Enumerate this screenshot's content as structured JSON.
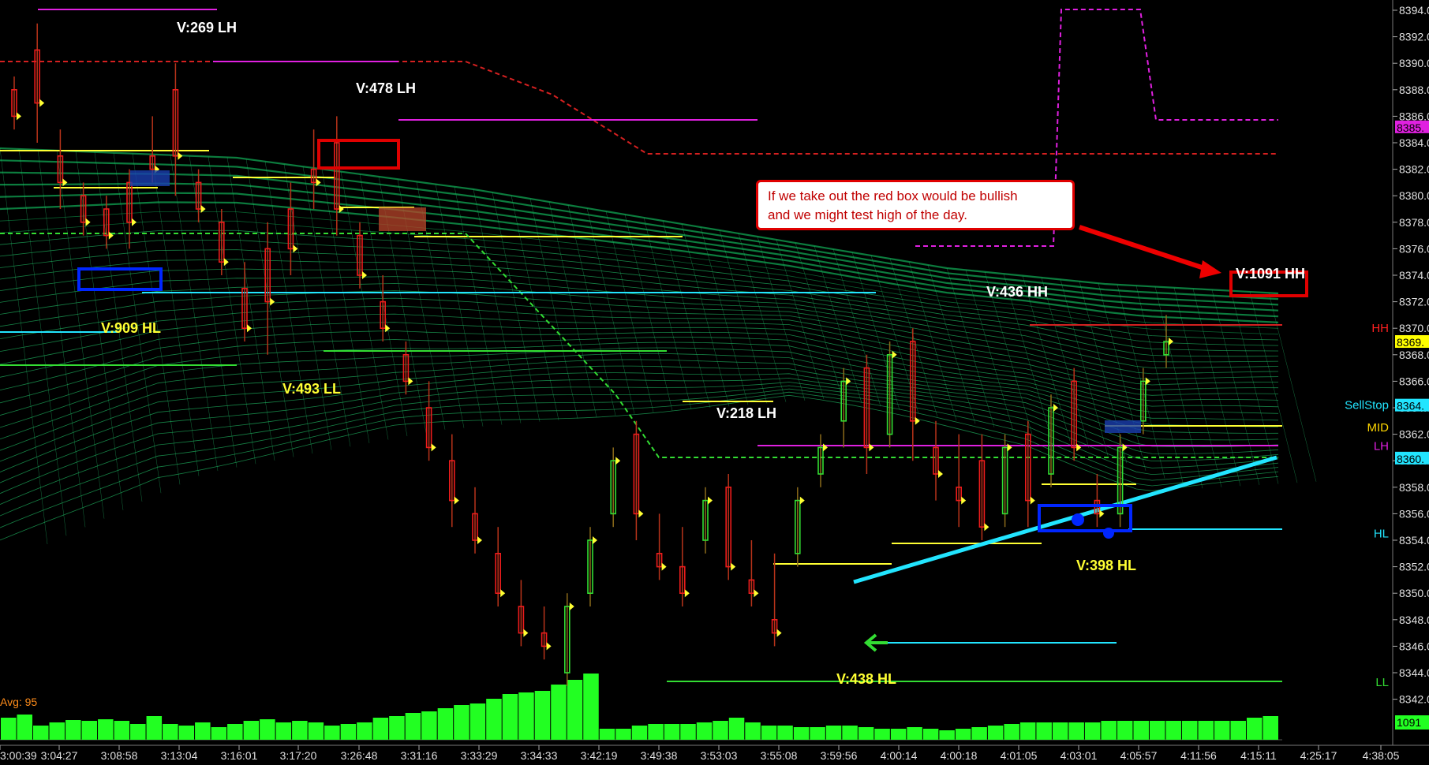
{
  "chart_data": {
    "type": "candlestick",
    "title": "",
    "ylim": [
      8342,
      8394.5
    ],
    "y_ticks": [
      "8394.0",
      "8392.0",
      "8390.0",
      "8388.0",
      "8386.0",
      "8384.0",
      "8382.0",
      "8380.0",
      "8378.0",
      "8376.0",
      "8374.0",
      "8372.0",
      "8370.0",
      "8368.0",
      "8366.0",
      "8364.0",
      "8362.0",
      "8360.0",
      "8358.0",
      "8356.0",
      "8354.0",
      "8352.0",
      "8350.0",
      "8348.0",
      "8346.0",
      "8344.0",
      "8342.0"
    ],
    "x_ticks": [
      "3:00:39",
      "3:04:27",
      "3:08:58",
      "3:13:04",
      "3:16:01",
      "3:17:20",
      "3:26:48",
      "3:31:16",
      "3:33:29",
      "3:34:33",
      "3:42:19",
      "3:49:38",
      "3:53:03",
      "3:55:08",
      "3:59:56",
      "4:00:14",
      "4:00:18",
      "4:01:05",
      "4:03:01",
      "4:05:57",
      "4:11:56",
      "4:15:11",
      "4:25:17",
      "4:38:05"
    ],
    "candles": [
      {
        "x": 0,
        "o": 8388,
        "h": 8389,
        "c": 8386,
        "l": 8385
      },
      {
        "x": 1,
        "o": 8391,
        "h": 8393,
        "c": 8387,
        "l": 8384
      },
      {
        "x": 2,
        "o": 8383,
        "h": 8385,
        "c": 8381,
        "l": 8379
      },
      {
        "x": 3,
        "o": 8380,
        "h": 8381,
        "c": 8378,
        "l": 8377
      },
      {
        "x": 4,
        "o": 8379,
        "h": 8380,
        "c": 8377,
        "l": 8376
      },
      {
        "x": 5,
        "o": 8381,
        "h": 8382,
        "c": 8378,
        "l": 8376
      },
      {
        "x": 6,
        "o": 8383,
        "h": 8386,
        "c": 8382,
        "l": 8381
      },
      {
        "x": 7,
        "o": 8388,
        "h": 8390,
        "c": 8383,
        "l": 8380
      },
      {
        "x": 8,
        "o": 8381,
        "h": 8382,
        "c": 8379,
        "l": 8378
      },
      {
        "x": 9,
        "o": 8378,
        "h": 8379,
        "c": 8375,
        "l": 8374
      },
      {
        "x": 10,
        "o": 8373,
        "h": 8375,
        "c": 8370,
        "l": 8369
      },
      {
        "x": 11,
        "o": 8376,
        "h": 8378,
        "c": 8372,
        "l": 8368
      },
      {
        "x": 12,
        "o": 8379,
        "h": 8381,
        "c": 8376,
        "l": 8374
      },
      {
        "x": 13,
        "o": 8382,
        "h": 8385,
        "c": 8381,
        "l": 8379
      },
      {
        "x": 14,
        "o": 8384,
        "h": 8386,
        "c": 8379,
        "l": 8377
      },
      {
        "x": 15,
        "o": 8377,
        "h": 8378,
        "c": 8374,
        "l": 8373
      },
      {
        "x": 16,
        "o": 8372,
        "h": 8374,
        "c": 8370,
        "l": 8369
      },
      {
        "x": 17,
        "o": 8368,
        "h": 8369,
        "c": 8366,
        "l": 8365
      },
      {
        "x": 18,
        "o": 8364,
        "h": 8366,
        "c": 8361,
        "l": 8360
      },
      {
        "x": 19,
        "o": 8360,
        "h": 8362,
        "c": 8357,
        "l": 8355
      },
      {
        "x": 20,
        "o": 8356,
        "h": 8358,
        "c": 8354,
        "l": 8353
      },
      {
        "x": 21,
        "o": 8353,
        "h": 8355,
        "c": 8350,
        "l": 8349
      },
      {
        "x": 22,
        "o": 8349,
        "h": 8351,
        "c": 8347,
        "l": 8346
      },
      {
        "x": 23,
        "o": 8347,
        "h": 8349,
        "c": 8346,
        "l": 8345
      },
      {
        "x": 24,
        "o": 8344,
        "h": 8350,
        "c": 8349,
        "l": 8343
      },
      {
        "x": 25,
        "o": 8350,
        "h": 8355,
        "c": 8354,
        "l": 8349
      },
      {
        "x": 26,
        "o": 8356,
        "h": 8361,
        "c": 8360,
        "l": 8355
      },
      {
        "x": 27,
        "o": 8362,
        "h": 8363,
        "c": 8356,
        "l": 8354
      },
      {
        "x": 28,
        "o": 8353,
        "h": 8356,
        "c": 8352,
        "l": 8351
      },
      {
        "x": 29,
        "o": 8352,
        "h": 8355,
        "c": 8350,
        "l": 8349
      },
      {
        "x": 30,
        "o": 8354,
        "h": 8358,
        "c": 8357,
        "l": 8353
      },
      {
        "x": 31,
        "o": 8358,
        "h": 8359,
        "c": 8352,
        "l": 8351
      },
      {
        "x": 32,
        "o": 8351,
        "h": 8354,
        "c": 8350,
        "l": 8349
      },
      {
        "x": 33,
        "o": 8348,
        "h": 8353,
        "c": 8347,
        "l": 8346
      },
      {
        "x": 34,
        "o": 8353,
        "h": 8358,
        "c": 8357,
        "l": 8352
      },
      {
        "x": 35,
        "o": 8359,
        "h": 8362,
        "c": 8361,
        "l": 8358
      },
      {
        "x": 36,
        "o": 8363,
        "h": 8367,
        "c": 8366,
        "l": 8361
      },
      {
        "x": 37,
        "o": 8367,
        "h": 8368,
        "c": 8361,
        "l": 8359
      },
      {
        "x": 38,
        "o": 8362,
        "h": 8369,
        "c": 8368,
        "l": 8361
      },
      {
        "x": 39,
        "o": 8369,
        "h": 8370,
        "c": 8363,
        "l": 8360
      },
      {
        "x": 40,
        "o": 8361,
        "h": 8363,
        "c": 8359,
        "l": 8357
      },
      {
        "x": 41,
        "o": 8358,
        "h": 8362,
        "c": 8357,
        "l": 8355
      },
      {
        "x": 42,
        "o": 8360,
        "h": 8362,
        "c": 8355,
        "l": 8354
      },
      {
        "x": 43,
        "o": 8356,
        "h": 8362,
        "c": 8361,
        "l": 8355
      },
      {
        "x": 44,
        "o": 8362,
        "h": 8363,
        "c": 8357,
        "l": 8355
      },
      {
        "x": 45,
        "o": 8359,
        "h": 8365,
        "c": 8364,
        "l": 8358
      },
      {
        "x": 46,
        "o": 8366,
        "h": 8367,
        "c": 8361,
        "l": 8360
      },
      {
        "x": 47,
        "o": 8357,
        "h": 8359,
        "c": 8356,
        "l": 8355
      },
      {
        "x": 48,
        "o": 8356,
        "h": 8362,
        "c": 8361,
        "l": 8355
      },
      {
        "x": 49,
        "o": 8363,
        "h": 8367,
        "c": 8366,
        "l": 8362
      },
      {
        "x": 50,
        "o": 8368,
        "h": 8371,
        "c": 8369,
        "l": 8367
      }
    ],
    "volume": {
      "avg_label": "Avg: 95",
      "last": "1091",
      "values": [
        28,
        32,
        18,
        22,
        25,
        24,
        26,
        24,
        20,
        30,
        20,
        18,
        22,
        16,
        20,
        24,
        26,
        22,
        24,
        22,
        18,
        20,
        22,
        28,
        30,
        34,
        36,
        40,
        44,
        46,
        52,
        58,
        60,
        62,
        70,
        76,
        84,
        14,
        14,
        18,
        20,
        20,
        20,
        22,
        24,
        28,
        22,
        18,
        18,
        16,
        16,
        18,
        18,
        16,
        14,
        14,
        16,
        14,
        12,
        14,
        16,
        18,
        20,
        22,
        22,
        22,
        22,
        22,
        24,
        24,
        24,
        24,
        24,
        24,
        24,
        24,
        24,
        28,
        30
      ]
    },
    "labels": [
      {
        "text": "V:269 LH",
        "color": "#ffffff"
      },
      {
        "text": "V:478 LH",
        "color": "#ffffff"
      },
      {
        "text": "V:909 HL",
        "color": "#ffff33"
      },
      {
        "text": "V:493 LL",
        "color": "#ffff33"
      },
      {
        "text": "V:218 LH",
        "color": "#ffffff"
      },
      {
        "text": "V:436 HH",
        "color": "#ffffff"
      },
      {
        "text": "V:1091 HH",
        "color": "#ffffff"
      },
      {
        "text": "V:398 HL",
        "color": "#ffff33"
      },
      {
        "text": "V:438 HL",
        "color": "#ffff33"
      }
    ],
    "right_levels": [
      {
        "name": "HH",
        "value": 8370.0,
        "color": "#ff2020"
      },
      {
        "name": "SellStop",
        "value": 8364.2,
        "color": "#22e5ff"
      },
      {
        "name": "MID",
        "value": 8362.5,
        "color": "#ffd700"
      },
      {
        "name": "LH",
        "value": 8361.1,
        "color": "#e020e0"
      },
      {
        "name": "HL",
        "value": 8354.5,
        "color": "#22e5ff"
      },
      {
        "name": "LL",
        "value": 8343.3,
        "color": "#33dd33"
      }
    ],
    "price_tags": [
      {
        "text": "8385.",
        "value": 8385.2,
        "bg": "#e020e0",
        "fg": "#000000"
      },
      {
        "text": "8369.",
        "value": 8369.0,
        "bg": "#ffff00",
        "fg": "#000000"
      },
      {
        "text": "8364.",
        "value": 8364.2,
        "bg": "#22e5ff",
        "fg": "#000000"
      },
      {
        "text": "8360.",
        "value": 8360.2,
        "bg": "#22e5ff",
        "fg": "#000000"
      }
    ],
    "grid": false
  },
  "annotation": {
    "line1": "If we take out the red box would be bullish",
    "line2": "and we might test high of the day."
  }
}
